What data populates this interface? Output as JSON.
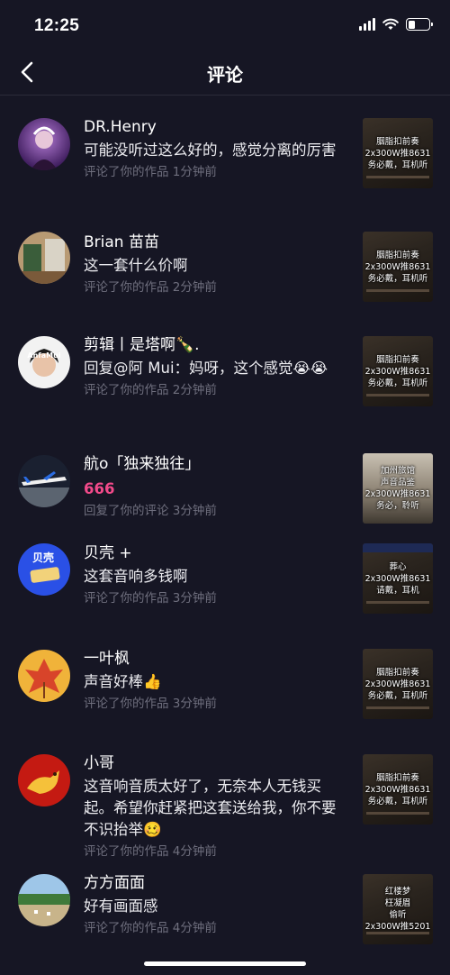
{
  "status_bar": {
    "time": "12:25",
    "battery_level": 0.35
  },
  "nav": {
    "title": "评论"
  },
  "comments": [
    {
      "username": "DR.Henry",
      "text": "可能没听过这么好的，感觉分离的厉害",
      "meta": "评论了你的作品  1分钟前",
      "thumb_lines": [
        "胭脂扣前奏",
        "2x300W推8631",
        "务必戴，耳机听"
      ]
    },
    {
      "username": "Brian 苗苗",
      "text": "这一套什么价啊",
      "meta": "评论了你的作品  2分钟前",
      "thumb_lines": [
        "胭脂扣前奏",
        "2x300W推8631",
        "务必戴，耳机听"
      ]
    },
    {
      "username": "剪辑丨是塔啊🍾.",
      "text": "回复@阿 Mui：妈呀，这个感觉😭😭",
      "meta": "评论了你的作品  2分钟前",
      "thumb_lines": [
        "胭脂扣前奏",
        "2x300W推8631",
        "务必戴，耳机听"
      ]
    },
    {
      "username": "航o「独来独往」",
      "text": "666",
      "meta": "回复了你的评论  3分钟前",
      "thumb_lines": [
        "加州旅馆",
        "声音品鉴",
        "2x300W推8631",
        "务必，聆听"
      ]
    },
    {
      "username": "贝壳 +",
      "text": "这套音响多钱啊",
      "meta": "评论了你的作品  3分钟前",
      "thumb_lines": [
        "葬心",
        "2x300W推8631",
        "请戴，耳机"
      ]
    },
    {
      "username": "一叶枫",
      "text": "声音好棒👍",
      "meta": "评论了你的作品  3分钟前",
      "thumb_lines": [
        "胭脂扣前奏",
        "2x300W推8631",
        "务必戴，耳机听"
      ]
    },
    {
      "username": "小哥",
      "text": "这音响音质太好了，无奈本人无钱买起。希望你赶紧把这套送给我，你不要不识抬举🥴",
      "meta": "评论了你的作品  4分钟前",
      "thumb_lines": [
        "胭脂扣前奏",
        "2x300W推8631",
        "务必戴，耳机听"
      ]
    },
    {
      "username": "方方面面",
      "text": "好有画面感",
      "meta": "评论了你的作品  4分钟前",
      "thumb_lines": [
        "红楼梦",
        "枉凝眉",
        "偷听",
        "2x300W推5201"
      ]
    }
  ],
  "avatars": {
    "beike_label": "贝壳"
  }
}
